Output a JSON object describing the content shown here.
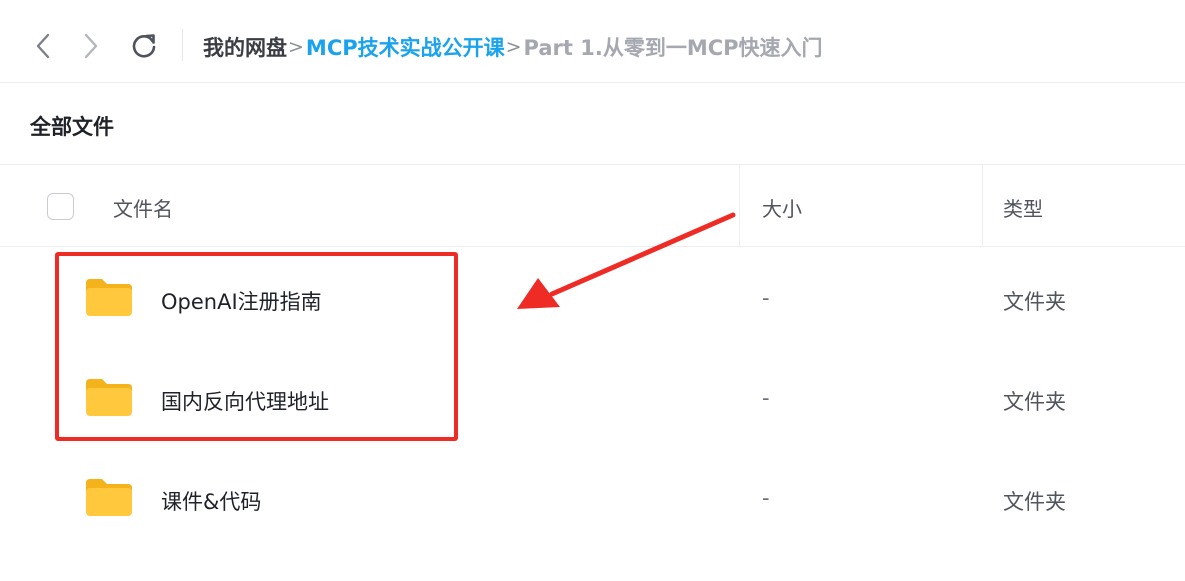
{
  "toolbar": {
    "back_icon": "chevron-left-icon",
    "forward_icon": "chevron-right-icon",
    "refresh_icon": "refresh-icon"
  },
  "breadcrumb": {
    "root": "我的网盘",
    "folder": "MCP技术实战公开课",
    "current": "Part 1.从零到一MCP快速入门",
    "separator": ">"
  },
  "section_title": "全部文件",
  "table": {
    "headers": {
      "name": "文件名",
      "size": "大小",
      "type": "类型"
    },
    "rows": [
      {
        "name": "OpenAI注册指南",
        "size": "-",
        "type": "文件夹",
        "icon": "folder-icon"
      },
      {
        "name": "国内反向代理地址",
        "size": "-",
        "type": "文件夹",
        "icon": "folder-icon"
      },
      {
        "name": "课件&代码",
        "size": "-",
        "type": "文件夹",
        "icon": "folder-icon"
      }
    ]
  },
  "colors": {
    "breadcrumb_link": "#1aa3ec",
    "folder": "#ffc83d",
    "annotation": "#ee2b24"
  }
}
